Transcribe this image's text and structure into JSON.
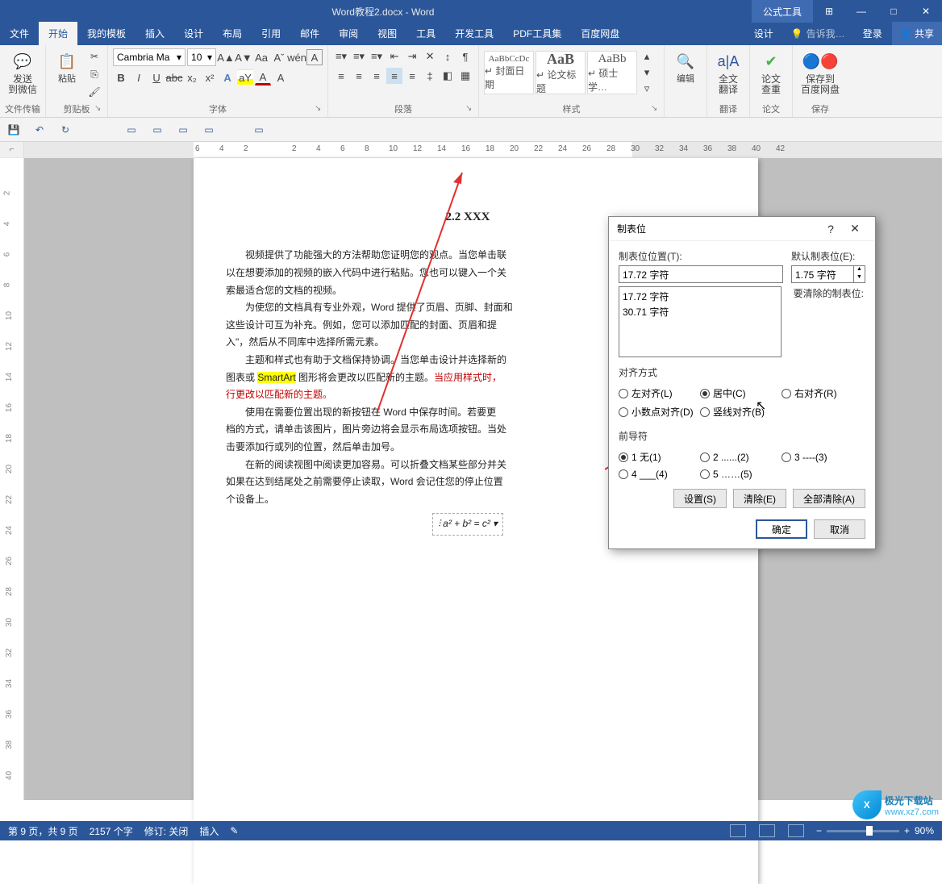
{
  "title": "Word教程2.docx - Word",
  "titlebar_extra": "公式工具",
  "window_buttons": {
    "ribbon_opts": "⊞",
    "min": "—",
    "max": "□",
    "close": "✕"
  },
  "tabs": [
    "文件",
    "开始",
    "我的模板",
    "插入",
    "设计",
    "布局",
    "引用",
    "邮件",
    "审阅",
    "视图",
    "工具",
    "开发工具",
    "PDF工具集",
    "百度网盘"
  ],
  "tabs_right": "设计",
  "tellme": "告诉我…",
  "login": "登录",
  "share": "共享",
  "ribbon": {
    "group1": {
      "a": "发送",
      "b": "到微信",
      "label": "文件传输"
    },
    "group2": {
      "a": "粘贴",
      "label": "剪贴板"
    },
    "font": {
      "name": "Cambria Ma",
      "size": "10",
      "btns_row1": [
        "A▲",
        "A▼",
        "Aa",
        "Aˇ",
        "wén",
        "A"
      ],
      "btns_row2": [
        "B",
        "I",
        "U",
        "abc",
        "x₂",
        "x²",
        "A",
        "aY",
        "A",
        "A"
      ],
      "label": "字体"
    },
    "para": {
      "label": "段落"
    },
    "styles": {
      "items": [
        {
          "pv": "AaBbCcDc",
          "lbl": "↵ 封面日期"
        },
        {
          "pv": "AaB",
          "lbl": "↵ 论文标题"
        },
        {
          "pv": "AaBb",
          "lbl": "↵ 硕士学…"
        }
      ],
      "label": "样式"
    },
    "edit": {
      "a": "编辑"
    },
    "trans": {
      "a": "全文",
      "b": "翻译",
      "label": "翻译"
    },
    "dup": {
      "a": "论文",
      "b": "查重",
      "label": "论文"
    },
    "save": {
      "a": "保存到",
      "b": "百度网盘",
      "label": "保存"
    }
  },
  "ruler_h": [
    "6",
    "4",
    "2",
    "",
    "2",
    "4",
    "6",
    "8",
    "10",
    "12",
    "14",
    "16",
    "18",
    "20",
    "22",
    "24",
    "26",
    "28",
    "30",
    "32",
    "34",
    "36",
    "38",
    "40",
    "42"
  ],
  "doc": {
    "title": "2.2 XXX",
    "p1a": "视频提供了功能强大的方法帮助您证明您的观点。当您单击联",
    "p1b": "以在想要添加的视频的嵌入代码中进行粘贴。您也可以键入一个关",
    "p1c": "索最适合您的文档的视频。",
    "p2a": "为使您的文档具有专业外观，Word 提供了页眉、页脚、封面和",
    "p2b": "这些设计可互为补充。例如，您可以添加匹配的封面、页眉和提",
    "p2c": "入\"，然后从不同库中选择所需元素。",
    "p3a": "主题和样式也有助于文档保持协调。当您单击设计并选择新的",
    "p3b": "图表或 ",
    "p3hl": "SmartArt",
    "p3c": " 图形将会更改以匹配新的主题。",
    "p3red": "当应用样式时，",
    "p3d": "行更改以匹配新的主题。",
    "p4a": "使用在需要位置出现的新按钮在 Word 中保存时间。若要更",
    "p4b": "档的方式，请单击该图片，图片旁边将会显示布局选项按钮。当处",
    "p4c": "击要添加行或列的位置，然后单击加号。",
    "p5a": "在新的阅读视图中阅读更加容易。可以折叠文档某些部分并关",
    "p5b": "如果在达到结尾处之前需要停止读取，Word 会记住您的停止位置",
    "p5c": "个设备上。",
    "eq": "a² + b² = c²"
  },
  "dialog": {
    "title": "制表位",
    "help": "?",
    "close": "✕",
    "pos_label": "制表位位置(T):",
    "def_label": "默认制表位(E):",
    "pos_value": "17.72 字符",
    "def_value": "1.75 字符",
    "list": [
      "17.72 字符",
      "30.71 字符"
    ],
    "clear_label": "要清除的制表位:",
    "align_label": "对齐方式",
    "align": [
      {
        "t": "左对齐(L)",
        "sel": false
      },
      {
        "t": "居中(C)",
        "sel": true
      },
      {
        "t": "右对齐(R)",
        "sel": false
      },
      {
        "t": "小数点对齐(D)",
        "sel": false
      },
      {
        "t": "竖线对齐(B)",
        "sel": false
      }
    ],
    "leader_label": "前导符",
    "leader": [
      {
        "t": "1 无(1)",
        "sel": true
      },
      {
        "t": "2 ......(2)",
        "sel": false
      },
      {
        "t": "3 ----(3)",
        "sel": false
      },
      {
        "t": "4 ___(4)",
        "sel": false
      },
      {
        "t": "5 ……(5)",
        "sel": false
      }
    ],
    "btns": {
      "set": "设置(S)",
      "clear": "清除(E)",
      "clearall": "全部清除(A)",
      "ok": "确定",
      "cancel": "取消"
    }
  },
  "status": {
    "page": "第 9 页，共 9 页",
    "words": "2157 个字",
    "track": "修订: 关闭",
    "insert": "插入",
    "zoom": "90%"
  },
  "watermark": {
    "brand": "极光下载站",
    "url": "www.xz7.com"
  }
}
